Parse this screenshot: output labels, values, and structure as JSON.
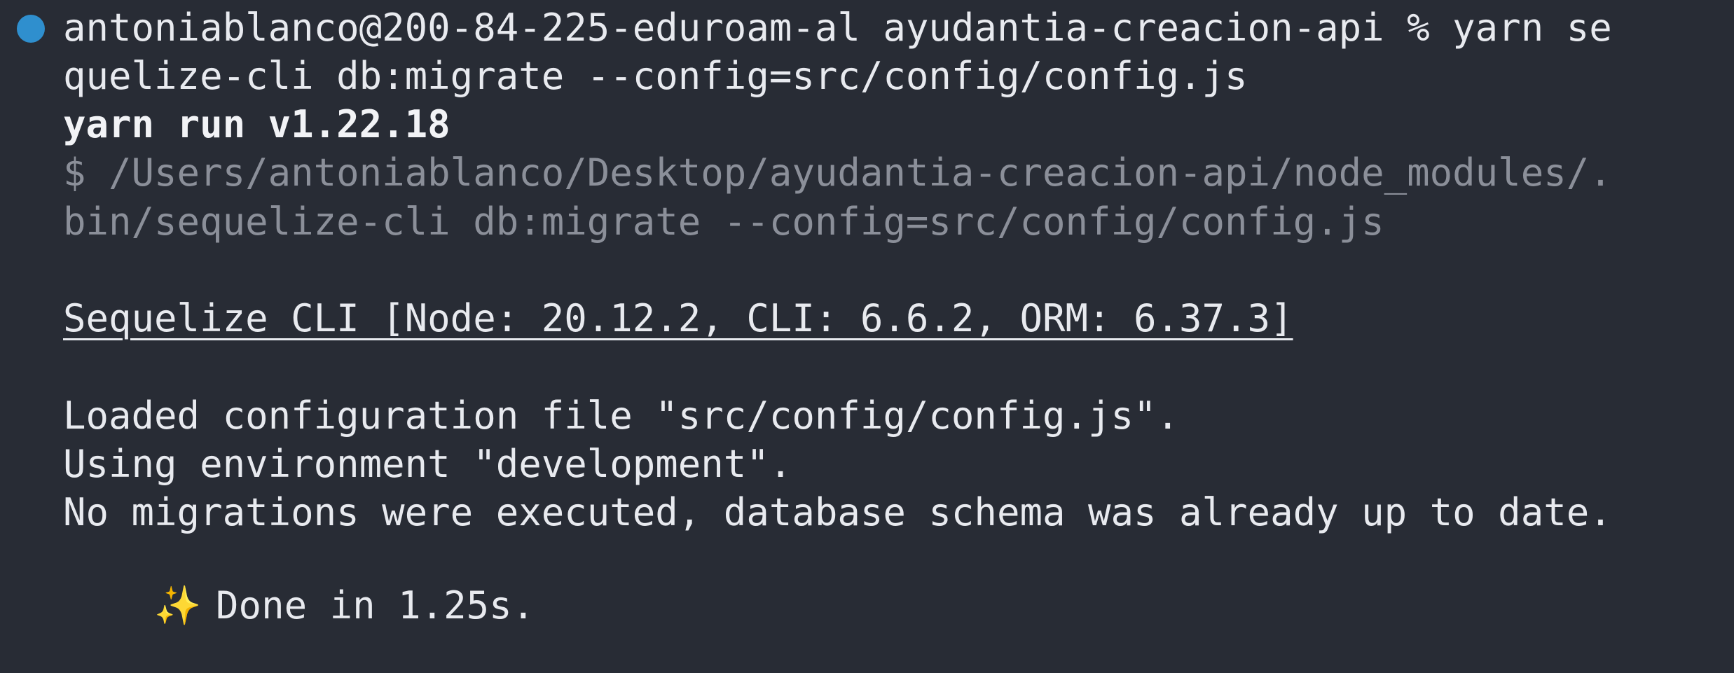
{
  "terminal": {
    "prompt": {
      "command_line_1": "antoniablanco@200-84-225-eduroam-al ayudantia-creacion-api % yarn se",
      "command_line_2": "quelize-cli db:migrate --config=src/config/config.js"
    },
    "output": {
      "yarn_version": "yarn run v1.22.18",
      "exec_line_1": "$ /Users/antoniablanco/Desktop/ayudantia-creacion-api/node_modules/.",
      "exec_line_2": "bin/sequelize-cli db:migrate --config=src/config/config.js",
      "sequelize_header": "Sequelize CLI [Node: 20.12.2, CLI: 6.6.2, ORM: 6.37.3]",
      "loaded_config": "Loaded configuration file \"src/config/config.js\".",
      "environment": "Using environment \"development\".",
      "migrations_status": "No migrations were executed, database schema was already up to date.",
      "done_icon": "✨",
      "done_text": "Done in 1.25s."
    },
    "colors": {
      "background": "#282c35",
      "prompt_dot": "#2f8fce",
      "text": "#e8eaef",
      "dim_text": "#8b8f99"
    },
    "icons": {
      "prompt_marker": "status-dot-icon",
      "done_marker": "sparkles-icon"
    }
  }
}
